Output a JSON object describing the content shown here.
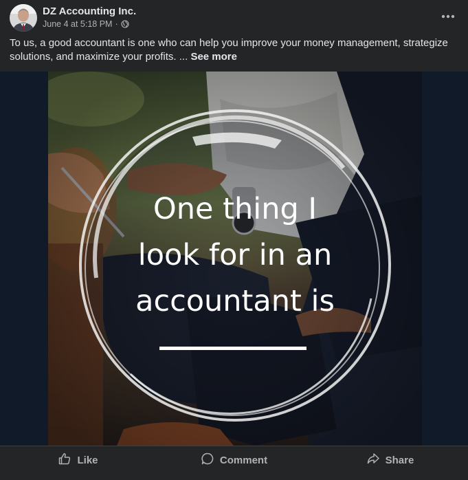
{
  "post": {
    "author": "DZ Accounting Inc.",
    "date": "June 4 at 5:18 PM",
    "separator": "·",
    "caption": "To us, a good accountant is one who can help you improve your money management, strategize solutions, and maximize your profits. ...",
    "see_more": "See more",
    "image_text_lines": [
      "One thing I",
      "look for in an",
      "accountant is"
    ]
  },
  "actions": {
    "like": "Like",
    "comment": "Comment",
    "share": "Share"
  },
  "icons": {
    "more": "more-options-icon",
    "privacy": "globe-icon",
    "like": "thumbs-up-icon",
    "comment": "comment-bubble-icon",
    "share": "share-arrow-icon"
  },
  "colors": {
    "background": "#242526",
    "text_primary": "#e4e6eb",
    "text_secondary": "#b0b3b8",
    "media_background": "#101a29"
  }
}
